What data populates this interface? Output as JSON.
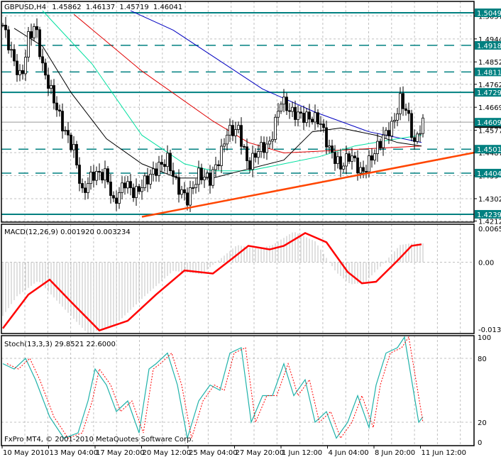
{
  "header": {
    "symbol": "GBPUSD,H4",
    "open": "1.45862",
    "high": "1.46137",
    "low": "1.45719",
    "close": "1.46041"
  },
  "macd_label": "MACD(12,26,9) 0.001920 0.003234",
  "stoch_label": "Stoch(13,3,3) 29.8521 22.6000",
  "copyright": "FxPro MT4, © 2001-2010 MetaQuotes Software Corp.",
  "colors": {
    "level": "#008080",
    "trend": "#ff4500",
    "ma_blue": "#0000c0",
    "ma_red": "#e00000",
    "ma_green": "#00e0a0",
    "ma_black": "#000000",
    "macd_hist": "#c0c0c0",
    "macd_signal": "#ff0000",
    "stoch_main": "#20b2aa",
    "stoch_signal": "#ff0000",
    "grid": "#c0c0c0"
  },
  "chart_data": [
    {
      "type": "candlestick",
      "title": "GBPUSD,H4",
      "ylim": [
        1.4212,
        1.506
      ],
      "price_ticks": [
        "1.50370",
        "1.49445",
        "1.48520",
        "1.47620",
        "1.46695",
        "1.45770",
        "1.44870",
        "1.43945",
        "1.43020",
        "1.42120"
      ],
      "levels": [
        {
          "price": "1.50496",
          "style": "solid"
        },
        {
          "price": "1.49185",
          "style": "dashed"
        },
        {
          "price": "1.48117",
          "style": "dashed"
        },
        {
          "price": "1.47295",
          "style": "solid"
        },
        {
          "price": "1.46096",
          "style": "thin"
        },
        {
          "price": "1.45011",
          "style": "dashed"
        },
        {
          "price": "1.44048",
          "style": "dashed"
        },
        {
          "price": "1.42392",
          "style": "solid"
        }
      ],
      "trendline": [
        [
          49,
          1.4229
        ],
        [
          166,
          1.4487
        ]
      ],
      "price_path": [
        [
          0,
          1.5
        ],
        [
          4,
          1.485
        ],
        [
          6.5,
          1.478
        ],
        [
          9,
          1.495
        ],
        [
          11.5,
          1.5
        ],
        [
          14,
          1.483
        ],
        [
          18,
          1.47
        ],
        [
          21.5,
          1.458
        ],
        [
          25,
          1.45
        ],
        [
          28,
          1.432
        ],
        [
          31.5,
          1.44
        ],
        [
          36.5,
          1.44
        ],
        [
          39,
          1.428
        ],
        [
          43,
          1.437
        ],
        [
          46.5,
          1.432
        ],
        [
          50,
          1.437
        ],
        [
          54,
          1.442
        ],
        [
          58,
          1.446
        ],
        [
          61.5,
          1.435
        ],
        [
          65,
          1.43
        ],
        [
          69,
          1.44
        ],
        [
          73,
          1.438
        ],
        [
          76.5,
          1.447
        ],
        [
          79,
          1.457
        ],
        [
          83,
          1.458
        ],
        [
          86.5,
          1.443
        ],
        [
          90,
          1.45
        ],
        [
          94,
          1.452
        ],
        [
          98,
          1.47
        ],
        [
          101.5,
          1.465
        ],
        [
          106.5,
          1.463
        ],
        [
          111.5,
          1.462
        ],
        [
          115,
          1.45
        ],
        [
          119,
          1.443
        ],
        [
          122.5,
          1.448
        ],
        [
          126.5,
          1.44
        ],
        [
          130,
          1.447
        ],
        [
          134,
          1.455
        ],
        [
          137.5,
          1.46
        ],
        [
          140,
          1.47
        ],
        [
          142.5,
          1.465
        ],
        [
          145,
          1.452
        ],
        [
          147.5,
          1.4604
        ]
      ],
      "moving_averages": [
        {
          "name": "ma_blue",
          "points": [
            [
              45,
              1.5058
            ],
            [
              60,
              1.498
            ],
            [
              91.5,
              1.4743
            ],
            [
              110,
              1.465
            ],
            [
              129,
              1.4571
            ],
            [
              147.5,
              1.4528
            ]
          ]
        },
        {
          "name": "ma_red",
          "points": [
            [
              25,
              1.5044
            ],
            [
              49,
              1.4815
            ],
            [
              74,
              1.4614
            ],
            [
              86.5,
              1.4528
            ],
            [
              99,
              1.4486
            ],
            [
              124,
              1.45
            ],
            [
              147.5,
              1.4514
            ]
          ]
        },
        {
          "name": "ma_green",
          "points": [
            [
              14,
              1.5058
            ],
            [
              31.5,
              1.4843
            ],
            [
              49,
              1.4557
            ],
            [
              64,
              1.4442
            ],
            [
              74,
              1.4414
            ],
            [
              86.5,
              1.4414
            ],
            [
              99,
              1.4442
            ],
            [
              111.5,
              1.4471
            ],
            [
              124,
              1.4514
            ],
            [
              139,
              1.4543
            ],
            [
              147.5,
              1.4557
            ]
          ]
        },
        {
          "name": "ma_black",
          "points": [
            [
              4,
              1.4987
            ],
            [
              14,
              1.4915
            ],
            [
              24,
              1.4729
            ],
            [
              36.5,
              1.4543
            ],
            [
              49,
              1.4442
            ],
            [
              61.5,
              1.4385
            ],
            [
              74,
              1.4385
            ],
            [
              84,
              1.4414
            ],
            [
              99,
              1.4457
            ],
            [
              109,
              1.4571
            ],
            [
              119,
              1.4586
            ],
            [
              131.5,
              1.4557
            ],
            [
              139,
              1.4528
            ],
            [
              147.5,
              1.4514
            ]
          ]
        }
      ]
    },
    {
      "type": "bar+line",
      "title": "MACD(12,26,9)",
      "ylim": [
        -0.01348,
        0.00658
      ],
      "ticks": [
        "0.00658",
        "0.00",
        "-0.01348"
      ],
      "signal": [
        [
          0,
          -0.0129
        ],
        [
          9,
          -0.0063
        ],
        [
          16.5,
          -0.0034
        ],
        [
          24,
          -0.0077
        ],
        [
          34,
          -0.0133
        ],
        [
          44,
          -0.0114
        ],
        [
          54,
          -0.0063
        ],
        [
          64,
          -0.0016
        ],
        [
          74,
          -0.0022
        ],
        [
          81.5,
          0.001
        ],
        [
          86.5,
          0.0032
        ],
        [
          94,
          0.0025
        ],
        [
          99,
          0.0032
        ],
        [
          106.5,
          0.0057
        ],
        [
          114,
          0.0039
        ],
        [
          121.5,
          -0.0019
        ],
        [
          126.5,
          -0.0041
        ],
        [
          131.5,
          -0.0038
        ],
        [
          139,
          0.0003
        ],
        [
          144,
          0.0032
        ],
        [
          147.5,
          0.0035
        ]
      ]
    },
    {
      "type": "line",
      "title": "Stoch(13,3,3)",
      "ylim": [
        0,
        100
      ],
      "ticks": [
        "100",
        "80",
        "20",
        "0"
      ],
      "main": [
        [
          0,
          75
        ],
        [
          4,
          70
        ],
        [
          8,
          80
        ],
        [
          11.5,
          60
        ],
        [
          16.5,
          25
        ],
        [
          21.5,
          5
        ],
        [
          26.5,
          10
        ],
        [
          30,
          40
        ],
        [
          32.5,
          70
        ],
        [
          36.5,
          55
        ],
        [
          40,
          30
        ],
        [
          44,
          40
        ],
        [
          48,
          10
        ],
        [
          51.5,
          70
        ],
        [
          54,
          75
        ],
        [
          58,
          85
        ],
        [
          61.5,
          55
        ],
        [
          65,
          5
        ],
        [
          69,
          40
        ],
        [
          73,
          55
        ],
        [
          76.5,
          50
        ],
        [
          80,
          85
        ],
        [
          84,
          90
        ],
        [
          87.5,
          20
        ],
        [
          91.5,
          45
        ],
        [
          95,
          45
        ],
        [
          99,
          75
        ],
        [
          102.5,
          45
        ],
        [
          106.5,
          60
        ],
        [
          110,
          20
        ],
        [
          114,
          30
        ],
        [
          117.5,
          5
        ],
        [
          121.5,
          20
        ],
        [
          125,
          45
        ],
        [
          129,
          15
        ],
        [
          131.5,
          55
        ],
        [
          135,
          85
        ],
        [
          139,
          90
        ],
        [
          141.5,
          100
        ],
        [
          144,
          60
        ],
        [
          146.5,
          20
        ],
        [
          148,
          25
        ]
      ]
    },
    {
      "type": "time_axis",
      "labels": [
        "10 May 2010",
        "13 May 04:00",
        "17 May 20:00",
        "20 May 12:00",
        "25 May 04:00",
        "27 May 20:00",
        "1 Jun 12:00",
        "4 Jun 04:00",
        "8 Jun 20:00",
        "11 Jun 12:00"
      ]
    }
  ]
}
